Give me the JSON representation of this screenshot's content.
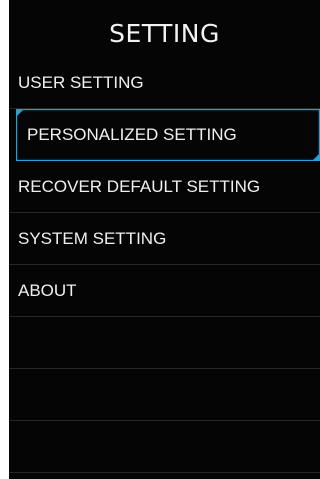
{
  "header": {
    "title": "SETTING"
  },
  "menu": {
    "items": [
      {
        "label": "USER SETTING"
      },
      {
        "label": "PERSONALIZED SETTING",
        "selected": true
      },
      {
        "label": "RECOVER DEFAULT SETTING"
      },
      {
        "label": "SYSTEM SETTING"
      },
      {
        "label": "ABOUT"
      }
    ],
    "empty_rows": 3
  },
  "colors": {
    "background": "#050505",
    "text": "#f0f0f0",
    "accent": "#2a9fd6",
    "divider": "#262626"
  }
}
